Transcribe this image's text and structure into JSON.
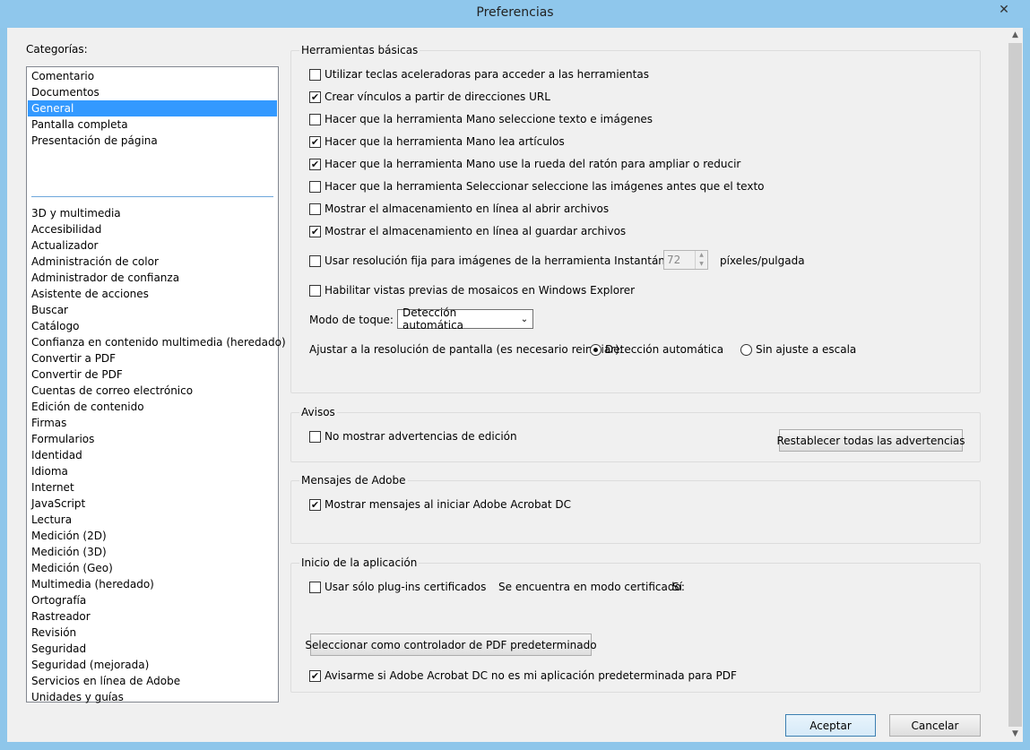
{
  "window": {
    "title": "Preferencias",
    "close_glyph": "✕",
    "close_icon": "close-icon"
  },
  "categories": {
    "label": "Categorías:",
    "top_items": [
      "Comentario",
      "Documentos",
      "General",
      "Pantalla completa",
      "Presentación de página"
    ],
    "selected": "General",
    "items": [
      "3D y multimedia",
      "Accesibilidad",
      "Actualizador",
      "Administración de color",
      "Administrador de confianza",
      "Asistente de acciones",
      "Buscar",
      "Catálogo",
      "Confianza en contenido multimedia (heredado)",
      "Convertir a PDF",
      "Convertir de PDF",
      "Cuentas de correo electrónico",
      "Edición de contenido",
      "Firmas",
      "Formularios",
      "Identidad",
      "Idioma",
      "Internet",
      "JavaScript",
      "Lectura",
      "Medición (2D)",
      "Medición (3D)",
      "Medición (Geo)",
      "Multimedia (heredado)",
      "Ortografía",
      "Rastreador",
      "Revisión",
      "Seguridad",
      "Seguridad (mejorada)",
      "Servicios en línea de Adobe",
      "Unidades y guías"
    ]
  },
  "basic_tools": {
    "title": "Herramientas básicas",
    "options": [
      {
        "label": "Utilizar teclas aceleradoras para acceder a las herramientas",
        "checked": false
      },
      {
        "label": "Crear vínculos a partir de direcciones URL",
        "checked": true
      },
      {
        "label": "Hacer que la herramienta Mano seleccione texto e imágenes",
        "checked": false
      },
      {
        "label": "Hacer que la herramienta Mano lea artículos",
        "checked": true
      },
      {
        "label": "Hacer que la herramienta Mano use la rueda del ratón para ampliar o reducir",
        "checked": true
      },
      {
        "label": "Hacer que la herramienta Seleccionar seleccione las imágenes antes que el texto",
        "checked": false
      },
      {
        "label": "Mostrar el almacenamiento en línea al abrir archivos",
        "checked": false
      },
      {
        "label": "Mostrar el almacenamiento en línea al guardar archivos",
        "checked": true
      }
    ],
    "snapshot": {
      "label": "Usar resolución fija para imágenes de la herramienta Instantánea:",
      "checked": false,
      "value": "72",
      "unit": "píxeles/pulgada"
    },
    "thumbnails": {
      "label": "Habilitar vistas previas de mosaicos en Windows Explorer",
      "checked": false
    },
    "touch_mode": {
      "label": "Modo de toque:",
      "value": "Detección automática"
    },
    "scaling": {
      "label": "Ajustar a la resolución de pantalla (es necesario reiniciar):",
      "option1": "Detección automática",
      "option2": "Sin ajuste a escala",
      "selected": "option1"
    }
  },
  "warnings": {
    "title": "Avisos",
    "option": {
      "label": "No mostrar advertencias de edición",
      "checked": false
    },
    "reset_button": "Restablecer todas las advertencias"
  },
  "adobe_messages": {
    "title": "Mensajes de Adobe",
    "option": {
      "label": "Mostrar mensajes al iniciar Adobe Acrobat DC",
      "checked": true
    }
  },
  "startup": {
    "title": "Inicio de la aplicación",
    "plugins": {
      "label": "Usar sólo plug-ins certificados",
      "checked": false
    },
    "certified_mode_label": "Se encuentra en modo certificado:",
    "certified_mode_value": "Sí",
    "default_handler_button": "Seleccionar como controlador de PDF predeterminado",
    "notify": {
      "label": "Avisarme si Adobe Acrobat DC no es mi aplicación predeterminada para PDF",
      "checked": true
    }
  },
  "footer": {
    "ok": "Aceptar",
    "cancel": "Cancelar"
  }
}
